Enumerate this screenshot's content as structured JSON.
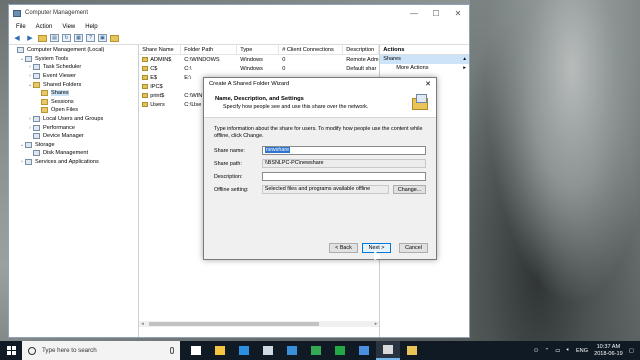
{
  "window": {
    "title": "Computer Management",
    "min": "—",
    "max": "☐",
    "close": "✕"
  },
  "menu": [
    "File",
    "Action",
    "View",
    "Help"
  ],
  "toolbar": [
    "back-arrow-icon",
    "forward-arrow-icon",
    "up-folder-icon",
    "show-hide-tree-icon",
    "refresh-icon",
    "export-list-icon",
    "help-icon",
    "properties-icon",
    "new-share-icon"
  ],
  "tree": [
    {
      "label": "Computer Management (Local)",
      "indent": 0,
      "exp": "",
      "icon": "computer-icon"
    },
    {
      "label": "System Tools",
      "indent": 1,
      "exp": "⌄",
      "icon": "tools-icon"
    },
    {
      "label": "Task Scheduler",
      "indent": 2,
      "exp": "›",
      "icon": "clock-icon"
    },
    {
      "label": "Event Viewer",
      "indent": 2,
      "exp": "›",
      "icon": "event-viewer-icon"
    },
    {
      "label": "Shared Folders",
      "indent": 2,
      "exp": "⌄",
      "icon": "shared-folder-icon"
    },
    {
      "label": "Shares",
      "indent": 3,
      "exp": "",
      "icon": "shares-icon",
      "selected": true
    },
    {
      "label": "Sessions",
      "indent": 3,
      "exp": "",
      "icon": "sessions-icon"
    },
    {
      "label": "Open Files",
      "indent": 3,
      "exp": "",
      "icon": "open-files-icon"
    },
    {
      "label": "Local Users and Groups",
      "indent": 2,
      "exp": "›",
      "icon": "users-icon"
    },
    {
      "label": "Performance",
      "indent": 2,
      "exp": "›",
      "icon": "performance-icon"
    },
    {
      "label": "Device Manager",
      "indent": 2,
      "exp": "",
      "icon": "device-manager-icon"
    },
    {
      "label": "Storage",
      "indent": 1,
      "exp": "⌄",
      "icon": "storage-icon"
    },
    {
      "label": "Disk Management",
      "indent": 2,
      "exp": "",
      "icon": "disk-icon"
    },
    {
      "label": "Services and Applications",
      "indent": 1,
      "exp": "›",
      "icon": "services-icon"
    }
  ],
  "list": {
    "columns": [
      "Share Name",
      "Folder Path",
      "Type",
      "# Client Connections",
      "Description"
    ],
    "rows": [
      [
        "ADMIN$",
        "C:\\WINDOWS",
        "Windows",
        "0",
        "Remote Adm"
      ],
      [
        "C$",
        "C:\\",
        "Windows",
        "0",
        "Default shar"
      ],
      [
        "E$",
        "E:\\",
        "",
        "",
        ""
      ],
      [
        "IPC$",
        "",
        "",
        "",
        ""
      ],
      [
        "print$",
        "C:\\WIN",
        "",
        "",
        ""
      ],
      [
        "Users",
        "C:\\Use",
        "",
        "",
        ""
      ]
    ]
  },
  "actions": {
    "header": "Actions",
    "section": "Shares",
    "item": "More Actions"
  },
  "dialog": {
    "title": "Create A Shared Folder Wizard",
    "close": "✕",
    "heading": "Name, Description, and Settings",
    "subheading": "Specify how people see and use this share over the network.",
    "intro": "Type information about the share for users. To modify how people use the content while offline, click Change.",
    "share_name_label": "Share name:",
    "share_name_value": "newshare",
    "share_path_label": "Share path:",
    "share_path_value": "\\\\BSNLPC-PC\\newshare",
    "description_label": "Description:",
    "description_value": "",
    "offline_label": "Offline setting:",
    "offline_value": "Selected files and programs available offline",
    "change_button": "Change...",
    "back_button": "< Back",
    "next_button": "Next >",
    "cancel_button": "Cancel"
  },
  "taskbar": {
    "search_placeholder": "Type here to search",
    "language": "ENG",
    "time": "10:37 AM",
    "date": "2018-06-19",
    "apps": [
      {
        "name": "task-view-icon",
        "color": "#ffffff"
      },
      {
        "name": "file-explorer-icon",
        "color": "#f4c542"
      },
      {
        "name": "edge-icon",
        "color": "#2c8fe0"
      },
      {
        "name": "store-icon",
        "color": "#cfd8e3"
      },
      {
        "name": "photos-icon",
        "color": "#3a8fd9"
      },
      {
        "name": "chrome-icon",
        "color": "#34a853"
      },
      {
        "name": "camtasia-icon",
        "color": "#22a845"
      },
      {
        "name": "app-icon",
        "color": "#4a8fe0"
      },
      {
        "name": "computer-management-icon",
        "color": "#d9d9d9"
      },
      {
        "name": "folder-icon",
        "color": "#e8c45a"
      }
    ]
  }
}
